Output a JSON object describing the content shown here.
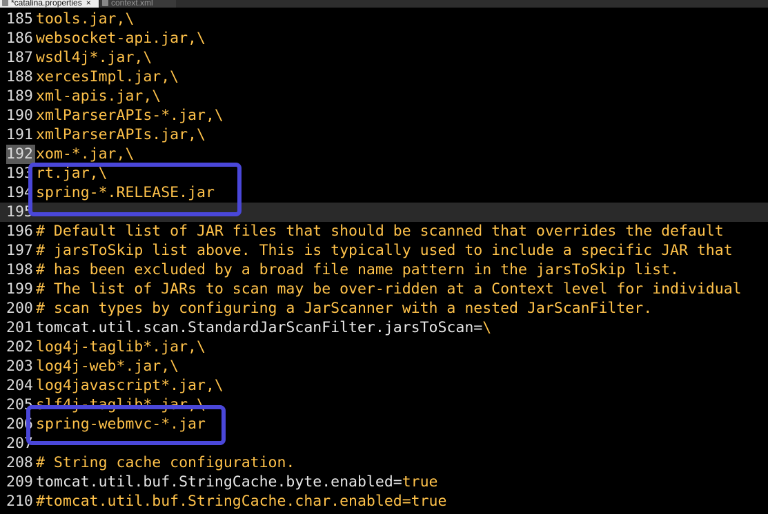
{
  "tabs": [
    {
      "label": "*catalina.properties",
      "close": "×",
      "active": true
    },
    {
      "label": "context.xml",
      "active": false
    }
  ],
  "lines": [
    {
      "num": "185",
      "text": "tools.jar,\\"
    },
    {
      "num": "186",
      "text": "websocket-api.jar,\\"
    },
    {
      "num": "187",
      "text": "wsdl4j*.jar,\\"
    },
    {
      "num": "188",
      "text": "xercesImpl.jar,\\"
    },
    {
      "num": "189",
      "text": "xml-apis.jar,\\"
    },
    {
      "num": "190",
      "text": "xmlParserAPIs-*.jar,\\"
    },
    {
      "num": "191",
      "text": "xmlParserAPIs.jar,\\"
    },
    {
      "num": "192",
      "text": "xom-*.jar,\\"
    },
    {
      "num": "193",
      "text": "rt.jar,\\"
    },
    {
      "num": "194",
      "text": "spring-*.RELEASE.jar"
    },
    {
      "num": "195",
      "text": ""
    },
    {
      "num": "196",
      "text": "# Default list of JAR files that should be scanned that overrides the default"
    },
    {
      "num": "197",
      "text": "# jarsToSkip list above. This is typically used to include a specific JAR that"
    },
    {
      "num": "198",
      "text": "# has been excluded by a broad file name pattern in the jarsToSkip list."
    },
    {
      "num": "199",
      "text": "# The list of JARs to scan may be over-ridden at a Context level for individual"
    },
    {
      "num": "200",
      "text": "# scan types by configuring a JarScanner with a nested JarScanFilter."
    },
    {
      "num": "201",
      "text": "tomcat.util.scan.StandardJarScanFilter.jarsToScan=",
      "value": "\\"
    },
    {
      "num": "202",
      "text": "log4j-taglib*.jar,\\"
    },
    {
      "num": "203",
      "text": "log4j-web*.jar,\\"
    },
    {
      "num": "204",
      "text": "log4javascript*.jar,\\"
    },
    {
      "num": "205",
      "text": "slf4j-taglib*.jar,\\"
    },
    {
      "num": "206",
      "text": "spring-webmvc-*.jar"
    },
    {
      "num": "207",
      "text": ""
    },
    {
      "num": "208",
      "text": "# String cache configuration."
    },
    {
      "num": "209",
      "text": "tomcat.util.buf.StringCache.byte.enabled=",
      "value": "true"
    },
    {
      "num": "210",
      "text": "#tomcat.util.buf.StringCache.char.enabled=true"
    }
  ],
  "colors": {
    "background": "#000000",
    "value_text": "#ffc24a",
    "key_text": "#e6e6e6",
    "line_number": "#dcdcdc",
    "annotation_box": "#4a47d9"
  }
}
